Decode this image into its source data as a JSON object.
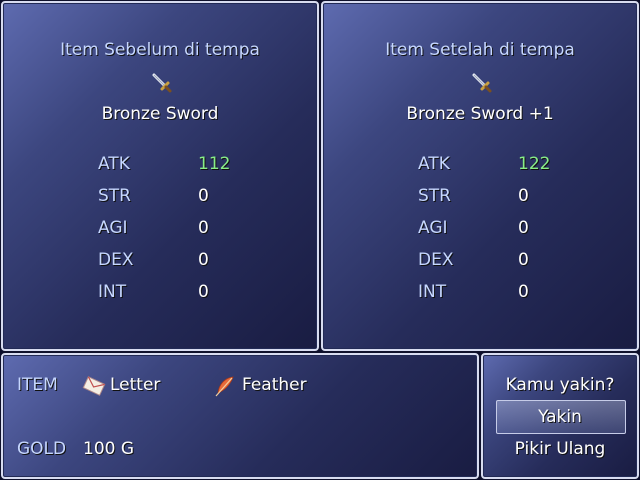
{
  "before": {
    "title": "Item Sebelum di tempa",
    "item_icon": "sword-icon",
    "item_name": "Bronze Sword",
    "stats": [
      {
        "label": "ATK",
        "value": "112",
        "highlight": true
      },
      {
        "label": "STR",
        "value": "0",
        "highlight": false
      },
      {
        "label": "AGI",
        "value": "0",
        "highlight": false
      },
      {
        "label": "DEX",
        "value": "0",
        "highlight": false
      },
      {
        "label": "INT",
        "value": "0",
        "highlight": false
      }
    ]
  },
  "after": {
    "title": "Item Setelah di tempa",
    "item_icon": "sword-icon",
    "item_name": "Bronze Sword +1",
    "stats": [
      {
        "label": "ATK",
        "value": "122",
        "highlight": true
      },
      {
        "label": "STR",
        "value": "0",
        "highlight": false
      },
      {
        "label": "AGI",
        "value": "0",
        "highlight": false
      },
      {
        "label": "DEX",
        "value": "0",
        "highlight": false
      },
      {
        "label": "INT",
        "value": "0",
        "highlight": false
      }
    ]
  },
  "materials": {
    "label": "ITEM",
    "items": [
      {
        "icon": "letter-icon",
        "name": "Letter"
      },
      {
        "icon": "feather-icon",
        "name": "Feather"
      }
    ],
    "gold_label": "GOLD",
    "gold_value": "100 G"
  },
  "confirm": {
    "question": "Kamu yakin?",
    "options": [
      "Yakin",
      "Pikir Ulang"
    ],
    "selected_index": 0
  },
  "colors": {
    "system_text": "#c6d7ff",
    "stat_increase": "#88ee88",
    "window_border": "#d8dcf0"
  }
}
